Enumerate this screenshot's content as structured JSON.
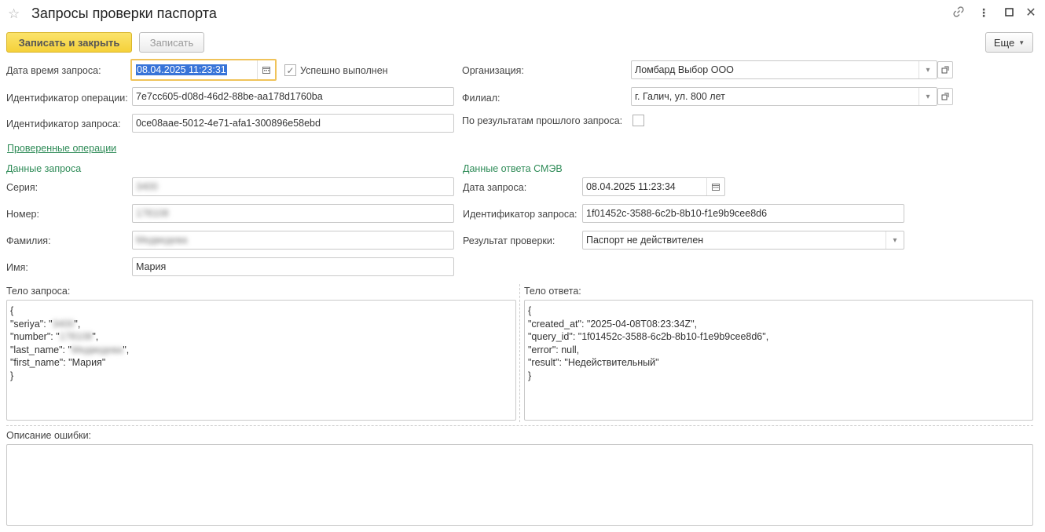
{
  "window": {
    "title": "Запросы проверки паспорта"
  },
  "toolbar": {
    "save_close_label": "Записать и закрыть",
    "save_label": "Записать",
    "more_label": "Еще"
  },
  "form": {
    "request_datetime_label": "Дата время запроса:",
    "request_datetime_value": "08.04.2025 11:23:31",
    "success_label": "Успешно выполнен",
    "operation_id_label": "Идентификатор операции:",
    "operation_id_value": "7e7cc605-d08d-46d2-88be-aa178d1760ba",
    "request_id_label": "Идентификатор запроса:",
    "request_id_value": "0ce08aae-5012-4e71-afa1-300896e58ebd",
    "organization_label": "Организация:",
    "organization_value": "Ломбард Выбор ООО",
    "branch_label": "Филиал:",
    "branch_value": "г. Галич, ул. 800 лет",
    "prev_result_label": "По результатам прошлого запроса:",
    "checked_operations_link": "Проверенные операции"
  },
  "request_data": {
    "section_title": "Данные запроса",
    "series_label": "Серия:",
    "series_value": "3400",
    "number_label": "Номер:",
    "number_value": "178108",
    "surname_label": "Фамилия:",
    "surname_value": "Медведева",
    "name_label": "Имя:",
    "name_value": "Мария"
  },
  "response_data": {
    "section_title": "Данные ответа СМЭВ",
    "request_date_label": "Дата запроса:",
    "request_date_value": "08.04.2025 11:23:34",
    "request_id_label": "Идентификатор запроса:",
    "request_id_value": "1f01452c-3588-6c2b-8b10-f1e9b9cee8d6",
    "result_label": "Результат проверки:",
    "result_value": "Паспорт не действителен"
  },
  "bodies": {
    "request_body_label": "Тело запроса:",
    "request_body_lines": [
      "{",
      "\"seriya\": \"",
      "\"number\": \"",
      "\"last_name\": \"",
      "\"first_name\": \"Мария\"",
      "}"
    ],
    "request_blur": [
      "3400",
      "178108",
      "Медведева"
    ],
    "request_tail": [
      "\",",
      "\",",
      "\","
    ],
    "response_body_label": "Тело ответа:",
    "response_body": "{\n\"created_at\": \"2025-04-08T08:23:34Z\",\n\"query_id\": \"1f01452c-3588-6c2b-8b10-f1e9b9cee8d6\",\n\"error\": null,\n\"result\": \"Недействительный\"\n}",
    "error_desc_label": "Описание ошибки:",
    "error_desc_value": ""
  }
}
